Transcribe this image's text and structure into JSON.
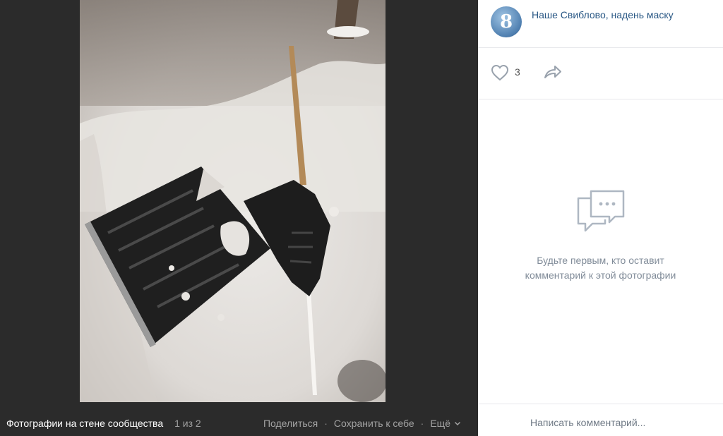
{
  "viewer": {
    "album_title": "Фотографии на стене сообщества",
    "counter": "1 из 2",
    "actions": {
      "share": "Поделиться",
      "separator": "·",
      "save": "Сохранить к себе",
      "more": "Ещё"
    }
  },
  "panel": {
    "group_name": "Наше Свиблово, надень маску",
    "avatar_letter": "8",
    "likes_count": "3",
    "empty_message_line1": "Будьте первым, кто оставит",
    "empty_message_line2": "комментарий к этой фотографии",
    "comment_placeholder": "Написать комментарий..."
  },
  "colors": {
    "viewer_background": "#2b2b2b",
    "panel_background": "#ffffff",
    "link": "#2a5885",
    "muted_text": "#818c99",
    "icon": "#aeb7c2"
  },
  "icons": {
    "like": "heart-icon",
    "share": "share-arrow-icon",
    "more": "chevron-down-icon",
    "empty_comments": "chat-bubble-icon"
  }
}
